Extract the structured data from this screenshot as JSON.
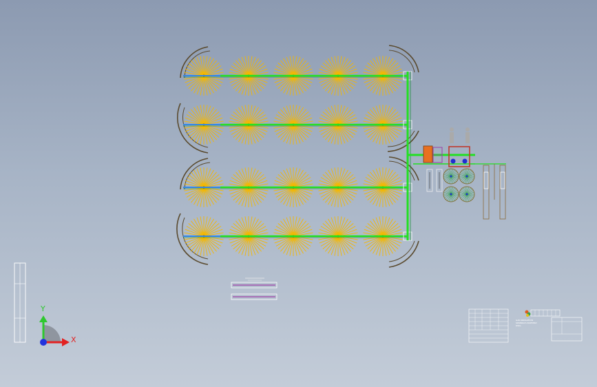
{
  "viewport": {
    "name": "CAD assembly viewport",
    "background_top": "#8c9ab1",
    "background_bottom": "#c3ccd8"
  },
  "drawing": {
    "sprinkler_color": "#f5b800",
    "main_pipe_color": "#22e022",
    "lateral_pipe_color": "#2f86e8",
    "hedge_color": "#5a4a2e",
    "frame_color": "#ffffff",
    "tank_color": "#c0392b",
    "pump_color": "#e87020",
    "valve_color": "#1f2fd1",
    "filter_color": "#8b6f3a",
    "accent_purple": "#9b3fa6",
    "rows": 4,
    "sprinklers_per_row": 5,
    "filters": 4
  },
  "triad": {
    "x_label": "X",
    "y_label": "Y",
    "x_color": "#e22222",
    "y_color": "#2ec82e",
    "z_color": "#2233dd"
  },
  "title_block": {
    "lines": [
      "GAN IRRIGATION",
      "SPRINKLE ASSEMBLY",
      "DWG"
    ]
  }
}
